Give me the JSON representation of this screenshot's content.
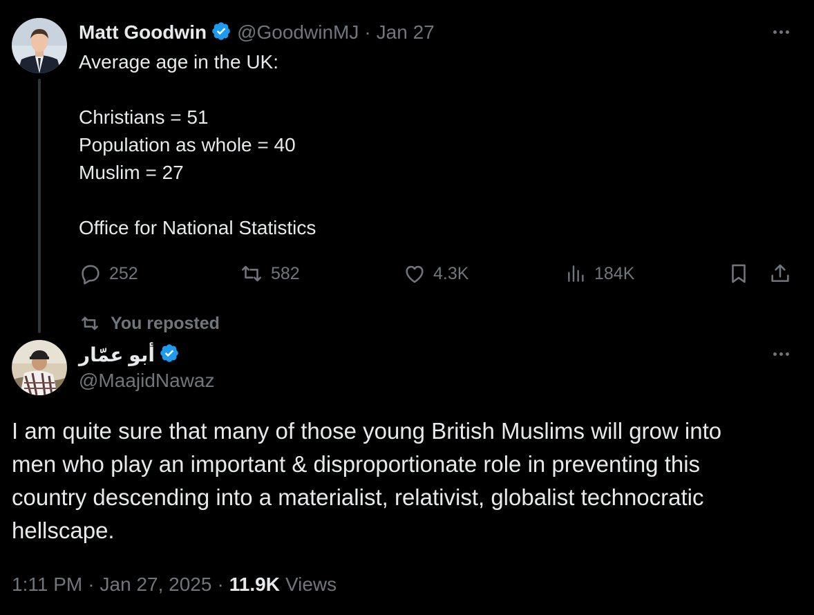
{
  "colors": {
    "background": "#000000",
    "text_primary": "#e7e9ea",
    "text_secondary": "#71767b",
    "verified_blue": "#1d9bf0",
    "thread_line": "#333639"
  },
  "quoted_tweet": {
    "author_name": "Matt Goodwin",
    "verified": true,
    "handle": "@GoodwinMJ",
    "separator": "·",
    "date": "Jan 27",
    "more_icon": "more-horizontal-icon",
    "body_lines": [
      "Average age in the UK:",
      "",
      "Christians = 51",
      "Population as whole = 40",
      "Muslim = 27",
      "",
      "Office for National Statistics"
    ],
    "actions": {
      "replies": "252",
      "reposts": "582",
      "likes": "4.3K",
      "views": "184K"
    }
  },
  "repost_label": {
    "icon": "repost-icon",
    "text": "You reposted"
  },
  "main_tweet": {
    "author_name": "أبو عمّار",
    "verified": true,
    "handle": "@MaajidNawaz",
    "more_icon": "more-horizontal-icon",
    "body_lines": [
      "I am quite sure that many of those young British Muslims will grow into",
      "men who play an important & disproportionate role in preventing this",
      "country descending into a materialist, relativist, globalist technocratic",
      "hellscape."
    ],
    "time": "1:11 PM",
    "separator": "·",
    "date": "Jan 27, 2025",
    "views_count": "11.9K",
    "views_label": "Views"
  }
}
